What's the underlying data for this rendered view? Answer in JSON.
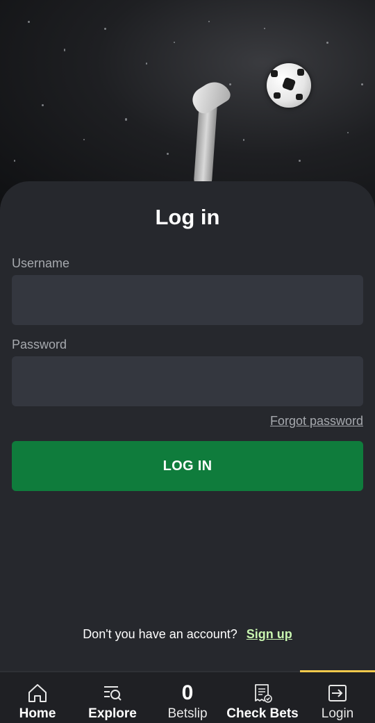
{
  "colors": {
    "accent_green": "#0f7c3c",
    "signup_link": "#c8f5b0",
    "active_tab_indicator": "#f2c94c",
    "card_bg": "#26282d",
    "field_bg": "#34373f"
  },
  "form": {
    "title": "Log in",
    "username_label": "Username",
    "username_value": "",
    "password_label": "Password",
    "password_value": "",
    "forgot_password": "Forgot password",
    "submit_label": "LOG IN",
    "no_account_text": "Don't you have an account?",
    "signup_link": "Sign up"
  },
  "nav": {
    "items": [
      {
        "label": "Home",
        "icon": "home-icon"
      },
      {
        "label": "Explore",
        "icon": "explore-search-icon"
      },
      {
        "label": "Betslip",
        "count": "0"
      },
      {
        "label": "Check Bets",
        "icon": "receipt-check-icon"
      },
      {
        "label": "Login",
        "icon": "login-arrow-icon",
        "active": true
      }
    ]
  }
}
